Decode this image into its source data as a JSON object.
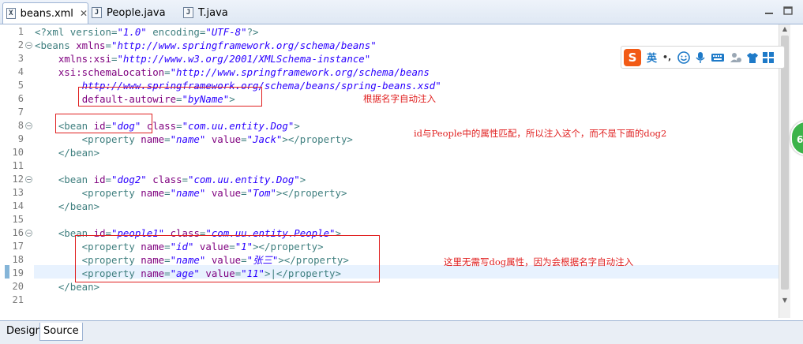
{
  "tabs": [
    {
      "label": "beans.xml",
      "icon": "xml-file-icon",
      "active": true,
      "closable": true
    },
    {
      "label": "People.java",
      "icon": "java-file-icon",
      "active": false
    },
    {
      "label": "T.java",
      "icon": "java-file-icon",
      "active": false
    }
  ],
  "lines": [
    {
      "n": "1",
      "fold": "",
      "tokens": [
        [
          "pi",
          "<?xml version="
        ],
        [
          "val",
          "\"1.0\""
        ],
        [
          "pi",
          " encoding="
        ],
        [
          "val",
          "\"UTF-8\""
        ],
        [
          "pi",
          "?>"
        ]
      ]
    },
    {
      "n": "2",
      "fold": "−",
      "tokens": [
        [
          "tag",
          "<beans "
        ],
        [
          "attr",
          "xmlns"
        ],
        [
          "tag",
          "="
        ],
        [
          "val",
          "\"http://www.springframework.org/schema/beans\""
        ]
      ]
    },
    {
      "n": "3",
      "fold": "",
      "tokens": [
        [
          "tag",
          "    "
        ],
        [
          "attr",
          "xmlns:xsi"
        ],
        [
          "tag",
          "="
        ],
        [
          "val",
          "\"http://www.w3.org/2001/XMLSchema-instance\""
        ]
      ]
    },
    {
      "n": "4",
      "fold": "",
      "tokens": [
        [
          "tag",
          "    "
        ],
        [
          "attr",
          "xsi:schemaLocation"
        ],
        [
          "tag",
          "="
        ],
        [
          "val",
          "\"http://www.springframework.org/schema/beans"
        ]
      ]
    },
    {
      "n": "5",
      "fold": "",
      "tokens": [
        [
          "val",
          "        http://www.springframework.org/schema/beans/spring-beans.xsd\""
        ]
      ]
    },
    {
      "n": "6",
      "fold": "",
      "tokens": [
        [
          "tag",
          "        "
        ],
        [
          "attr",
          "default-autowire"
        ],
        [
          "tag",
          "="
        ],
        [
          "val",
          "\"byName\""
        ],
        [
          "tag",
          ">"
        ]
      ]
    },
    {
      "n": "7",
      "fold": "",
      "tokens": []
    },
    {
      "n": "8",
      "fold": "−",
      "tokens": [
        [
          "tag",
          "    <bean "
        ],
        [
          "attr",
          "id"
        ],
        [
          "tag",
          "="
        ],
        [
          "val",
          "\"dog\""
        ],
        [
          "tag",
          " "
        ],
        [
          "attr",
          "class"
        ],
        [
          "tag",
          "="
        ],
        [
          "val",
          "\"com.uu.entity.Dog\""
        ],
        [
          "tag",
          ">"
        ]
      ]
    },
    {
      "n": "9",
      "fold": "",
      "tokens": [
        [
          "tag",
          "        <property "
        ],
        [
          "attr",
          "name"
        ],
        [
          "tag",
          "="
        ],
        [
          "val",
          "\"name\""
        ],
        [
          "tag",
          " "
        ],
        [
          "attr",
          "value"
        ],
        [
          "tag",
          "="
        ],
        [
          "val",
          "\"Jack\""
        ],
        [
          "tag",
          "></property>"
        ]
      ]
    },
    {
      "n": "10",
      "fold": "",
      "tokens": [
        [
          "tag",
          "    </bean>"
        ]
      ]
    },
    {
      "n": "11",
      "fold": "",
      "tokens": []
    },
    {
      "n": "12",
      "fold": "−",
      "tokens": [
        [
          "tag",
          "    <bean "
        ],
        [
          "attr",
          "id"
        ],
        [
          "tag",
          "="
        ],
        [
          "val",
          "\"dog2\""
        ],
        [
          "tag",
          " "
        ],
        [
          "attr",
          "class"
        ],
        [
          "tag",
          "="
        ],
        [
          "val",
          "\"com.uu.entity.Dog\""
        ],
        [
          "tag",
          ">"
        ]
      ]
    },
    {
      "n": "13",
      "fold": "",
      "tokens": [
        [
          "tag",
          "        <property "
        ],
        [
          "attr",
          "name"
        ],
        [
          "tag",
          "="
        ],
        [
          "val",
          "\"name\""
        ],
        [
          "tag",
          " "
        ],
        [
          "attr",
          "value"
        ],
        [
          "tag",
          "="
        ],
        [
          "val",
          "\"Tom\""
        ],
        [
          "tag",
          "></property>"
        ]
      ]
    },
    {
      "n": "14",
      "fold": "",
      "tokens": [
        [
          "tag",
          "    </bean>"
        ]
      ]
    },
    {
      "n": "15",
      "fold": "",
      "tokens": []
    },
    {
      "n": "16",
      "fold": "−",
      "tokens": [
        [
          "tag",
          "    <bean "
        ],
        [
          "attr",
          "id"
        ],
        [
          "tag",
          "="
        ],
        [
          "val",
          "\"people1\""
        ],
        [
          "tag",
          " "
        ],
        [
          "attr",
          "class"
        ],
        [
          "tag",
          "="
        ],
        [
          "val",
          "\"com.uu.entity.People\""
        ],
        [
          "tag",
          ">"
        ]
      ]
    },
    {
      "n": "17",
      "fold": "",
      "tokens": [
        [
          "tag",
          "        <property "
        ],
        [
          "attr",
          "name"
        ],
        [
          "tag",
          "="
        ],
        [
          "val",
          "\"id\""
        ],
        [
          "tag",
          " "
        ],
        [
          "attr",
          "value"
        ],
        [
          "tag",
          "="
        ],
        [
          "val",
          "\"1\""
        ],
        [
          "tag",
          "></property>"
        ]
      ]
    },
    {
      "n": "18",
      "fold": "",
      "tokens": [
        [
          "tag",
          "        <property "
        ],
        [
          "attr",
          "name"
        ],
        [
          "tag",
          "="
        ],
        [
          "val",
          "\"name\""
        ],
        [
          "tag",
          " "
        ],
        [
          "attr",
          "value"
        ],
        [
          "tag",
          "="
        ],
        [
          "val",
          "\"张三\""
        ],
        [
          "tag",
          "></property>"
        ]
      ]
    },
    {
      "n": "19",
      "fold": "",
      "tokens": [
        [
          "tag",
          "        <property "
        ],
        [
          "attr",
          "name"
        ],
        [
          "tag",
          "="
        ],
        [
          "val",
          "\"age\""
        ],
        [
          "tag",
          " "
        ],
        [
          "attr",
          "value"
        ],
        [
          "tag",
          "="
        ],
        [
          "val",
          "\"11\""
        ],
        [
          "tag",
          ">|</property>"
        ]
      ]
    },
    {
      "n": "20",
      "fold": "",
      "tokens": [
        [
          "tag",
          "    </bean>"
        ]
      ]
    },
    {
      "n": "21",
      "fold": "",
      "tokens": []
    }
  ],
  "annotations": {
    "by_name": "根据名字自动注入",
    "id_match": "id与People中的属性匹配，所以注入这个，而不是下面的dog2",
    "no_dog": "这里无需写dog属性，因为会根据名字自动注入"
  },
  "ime": {
    "lang": "英",
    "punct": "•,"
  },
  "badge": "6",
  "bottom_tabs": {
    "design": "Design",
    "source": "Source"
  }
}
